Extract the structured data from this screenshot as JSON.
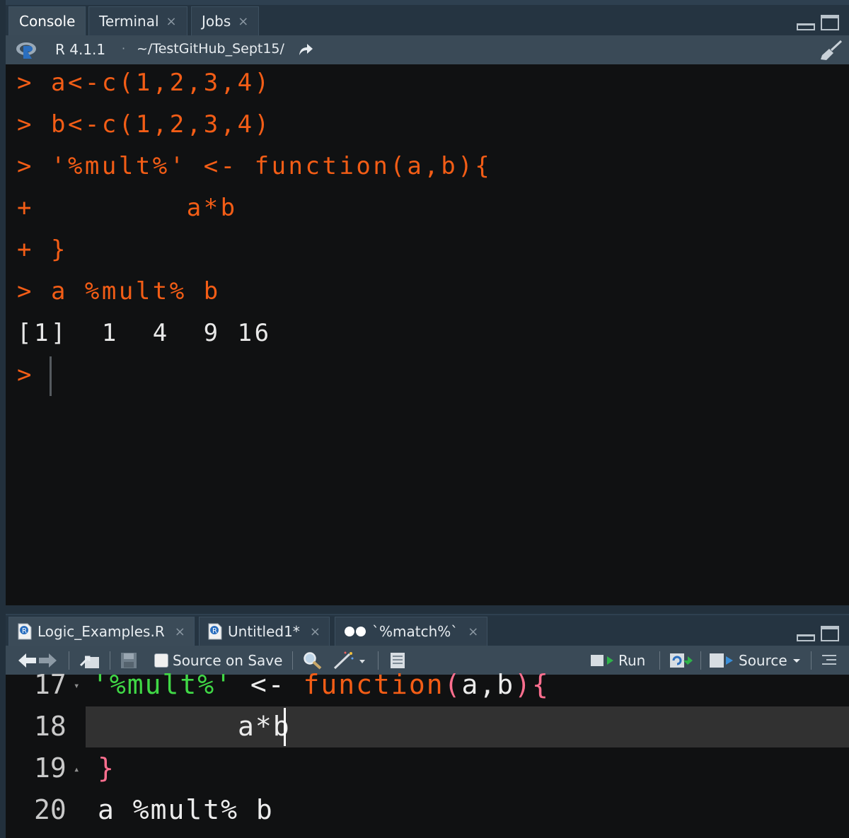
{
  "console_pane": {
    "tabs": [
      {
        "label": "Console",
        "closable": false
      },
      {
        "label": "Terminal",
        "closable": true
      },
      {
        "label": "Jobs",
        "closable": true
      }
    ],
    "close_glyph": "×",
    "r_version": "R 4.1.1",
    "separator": "·",
    "working_dir": "~/TestGitHub_Sept15/",
    "icons": [
      "r-logo-icon",
      "share-arrow-icon",
      "broom-icon",
      "minimize-icon",
      "maximize-icon"
    ],
    "lines": [
      {
        "prompt": ">",
        "code": "a<-c(1,2,3,4)",
        "color": "#f35d16"
      },
      {
        "prompt": ">",
        "code": "b<-c(1,2,3,4)",
        "color": "#f35d16"
      },
      {
        "prompt": ">",
        "code": "'%mult%' <- function(a,b){",
        "color": "#f35d16"
      },
      {
        "prompt": "+",
        "code": "        a*b",
        "color": "#f35d16"
      },
      {
        "prompt": "+",
        "code": "}",
        "color": "#f35d16"
      },
      {
        "prompt": ">",
        "code": "a %mult% b",
        "color": "#f35d16"
      }
    ],
    "output": "[1]  1  4  9 16",
    "current_prompt": ">"
  },
  "editor_pane": {
    "tabs": [
      {
        "label": "Logic_Examples.R",
        "icon": "r-file-icon"
      },
      {
        "label": "Untitled1*",
        "icon": "r-file-icon"
      },
      {
        "label": "`%match%`",
        "icon": "binoculars-icon"
      }
    ],
    "toolbar": {
      "source_on_save": "Source on Save",
      "run": "Run",
      "source": "Source",
      "icons": [
        "back-icon",
        "forward-icon",
        "show-in-window-icon",
        "save-icon",
        "search-icon",
        "magic-wand-icon",
        "notebook-icon",
        "rerun-icon",
        "outline-icon"
      ]
    },
    "lines": [
      {
        "num": "17",
        "fold": "▾"
      },
      {
        "num": "18",
        "fold": ""
      },
      {
        "num": "19",
        "fold": "▴"
      },
      {
        "num": "20",
        "fold": ""
      }
    ],
    "code": {
      "l17_string": "'%mult%'",
      "l17_assign": " <- ",
      "l17_kw": "function",
      "l17_open": "(",
      "l17_args": "a,b",
      "l17_close": ")",
      "l17_brace": "{",
      "l18": "a*b",
      "l19": "}",
      "l20": "a %mult% b"
    },
    "colors": {
      "string": "#40d846",
      "keyword": "#f35d16",
      "paren": "#ff6f8f",
      "text": "#ececec"
    }
  }
}
